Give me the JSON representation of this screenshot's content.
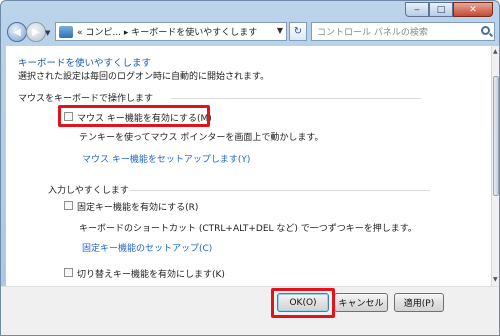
{
  "window": {
    "nav": {
      "address_prefix": "«",
      "breadcrumb_1": "コンピ...",
      "separator": "▸",
      "breadcrumb_2": "キーボードを使いやすくします"
    },
    "search": {
      "placeholder": "コントロール パネルの検索"
    }
  },
  "page": {
    "title": "キーボードを使いやすくします",
    "subtitle": "選択された設定は毎回のログオン時に自動的に開始されます。",
    "mouse_group": {
      "label": "マウスをキーボードで操作します",
      "mouse_keys_checkbox": {
        "label": "マウス キー機能を有効にする(M)",
        "checked": false
      },
      "mouse_keys_desc": "テンキーを使ってマウス ポインターを画面上で動かします。",
      "mouse_keys_setup_link": "マウス キー機能をセットアップします(Y)"
    },
    "typing_group": {
      "label": "入力しやすくします",
      "sticky_keys_checkbox": {
        "label": "固定キー機能を有効にする(R)",
        "checked": false
      },
      "sticky_keys_desc": "キーボードのショートカット (CTRL+ALT+DEL など) で一つずつキーを押します。",
      "sticky_keys_setup_link": "固定キー機能のセットアップ(C)",
      "toggle_keys_checkbox": {
        "label": "切り替えキー機能を有効にします(K)",
        "checked": false
      }
    }
  },
  "footer": {
    "ok_label": "OK(O)",
    "cancel_label": "キャンセル",
    "apply_label": "適用(P)"
  },
  "colors": {
    "highlight": "#e0141b",
    "link": "#1f66c9",
    "heading": "#1c5aa6"
  }
}
